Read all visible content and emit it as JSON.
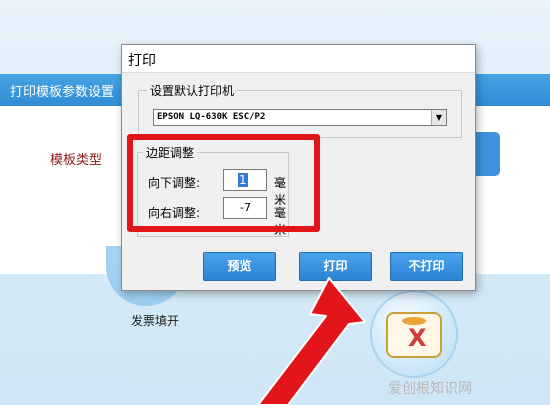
{
  "app": {
    "title": "打印模板参数设置",
    "template_type_label": "模板类型",
    "invoice_label": "发票填开"
  },
  "dialog": {
    "title": "打印",
    "printer_group_label": "设置默认打印机",
    "printer_value": "EPSON LQ-630K ESC/P2",
    "margin_group_label": "边距调整",
    "down_label": "向下调整:",
    "down_value": "1",
    "right_label": "向右调整:",
    "right_value": "-7",
    "unit": "毫米",
    "buttons": {
      "preview": "预览",
      "print": "打印",
      "no_print": "不打印"
    }
  },
  "icons": {
    "dropdown": "chevron-down-icon",
    "cancel_icon": "x-icon"
  },
  "colors": {
    "accent": "#2f8dd6",
    "highlight_box": "#e2151b",
    "arrow": "#e2151b"
  },
  "watermark": "爱创根知识网"
}
